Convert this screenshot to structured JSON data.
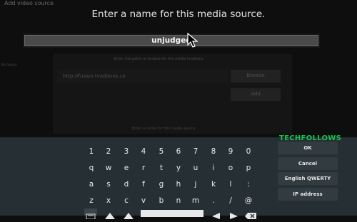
{
  "background_dialog": {
    "title": "Add video source",
    "side_label": "Browse",
    "hint": "Enter the paths or browse for the media locations",
    "url": "http://fusion.tvaddons.co",
    "browse_label": "Browse",
    "add_label": "Add",
    "bottom_hint": "Enter a name for this media source"
  },
  "dialog": {
    "heading": "Enter a name for this media source.",
    "input_value": "unjudged"
  },
  "keyboard": {
    "rows": [
      [
        "1",
        "2",
        "3",
        "4",
        "5",
        "6",
        "7",
        "8",
        "9",
        "0"
      ],
      [
        "q",
        "w",
        "e",
        "r",
        "t",
        "y",
        "u",
        "i",
        "o",
        "p"
      ],
      [
        "a",
        "s",
        "d",
        "f",
        "g",
        "h",
        "j",
        "k",
        "l",
        ":"
      ],
      [
        "z",
        "x",
        "c",
        "v",
        "b",
        "n",
        "m",
        ".",
        "/",
        "@"
      ]
    ],
    "ok_label": "OK",
    "cancel_label": "Cancel",
    "layout_label": "English QWERTY",
    "ip_label": "IP address",
    "brand": "TECHFOLLOWS"
  },
  "colors": {
    "keyboard_bg": "#262f33",
    "side_button_bg": "#313b40",
    "brand_green": "#19c44e"
  }
}
